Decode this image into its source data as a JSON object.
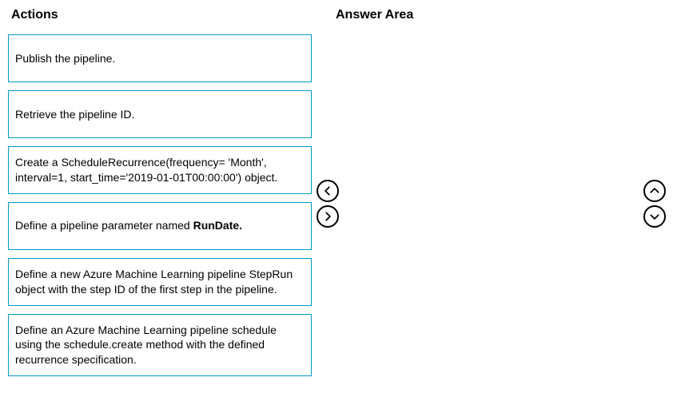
{
  "headings": {
    "actions": "Actions",
    "answer": "Answer Area"
  },
  "actions": [
    {
      "text": "Publish the pipeline."
    },
    {
      "text": "Retrieve the pipeline ID."
    },
    {
      "text": "Create a ScheduleRecurrence(frequency= 'Month', interval=1, start_time='2019-01-01T00:00:00') object."
    },
    {
      "prefix": "Define a pipeline parameter named ",
      "bold": "RunDate."
    },
    {
      "text": "Define a new Azure Machine Learning pipeline StepRun object with the step ID of the first step in the pipeline."
    },
    {
      "text": "Define an Azure Machine Learning pipeline schedule using the schedule.create method with the defined recurrence specification."
    }
  ],
  "controls": {
    "left": "chevron-left",
    "right": "chevron-right",
    "up": "chevron-up",
    "down": "chevron-down"
  }
}
